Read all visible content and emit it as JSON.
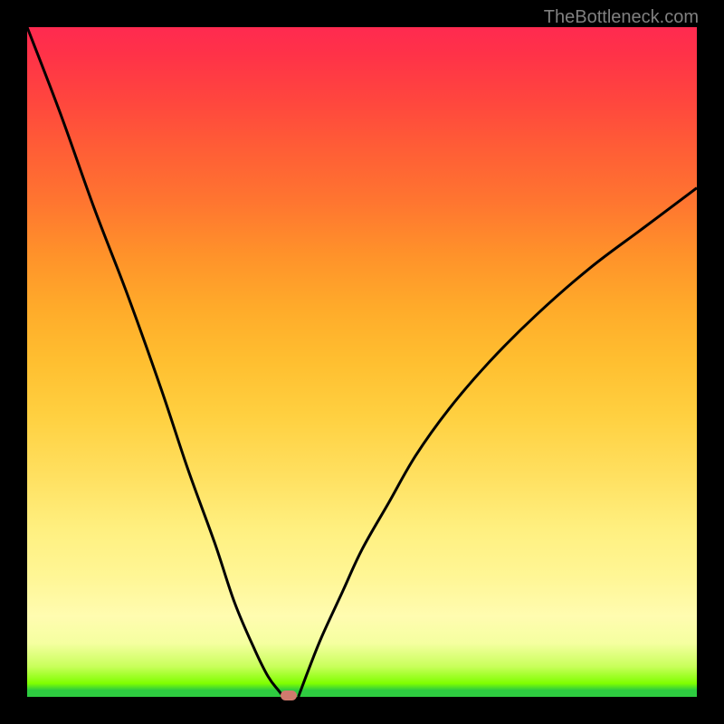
{
  "watermark": "TheBottleneck.com",
  "chart_data": {
    "type": "line",
    "title": "",
    "xlabel": "",
    "ylabel": "",
    "xlim": [
      0,
      100
    ],
    "ylim": [
      0,
      100
    ],
    "series": [
      {
        "name": "left-branch",
        "x": [
          0,
          5,
          10,
          15,
          20,
          24,
          28,
          31,
          34,
          36,
          37.5,
          38.3
        ],
        "y": [
          100,
          87,
          73,
          60,
          46,
          34,
          23,
          14,
          7,
          3,
          1,
          0
        ]
      },
      {
        "name": "right-branch",
        "x": [
          40.5,
          42,
          44,
          47,
          50,
          54,
          58,
          63,
          69,
          76,
          84,
          92,
          100
        ],
        "y": [
          0,
          4,
          9,
          15.5,
          22,
          29,
          36,
          43,
          50,
          57,
          64,
          70,
          76
        ]
      }
    ],
    "marker": {
      "x": 39,
      "y": 0,
      "color": "#d07a6e"
    },
    "gradient": {
      "stops": [
        "#2ecc40",
        "#7fff00",
        "#f5ffa0",
        "#fffcb0",
        "#fff080",
        "#ffd040",
        "#ffab2a",
        "#ff7530",
        "#ff463e",
        "#ff2a50"
      ],
      "direction": "bottom-to-top"
    }
  }
}
